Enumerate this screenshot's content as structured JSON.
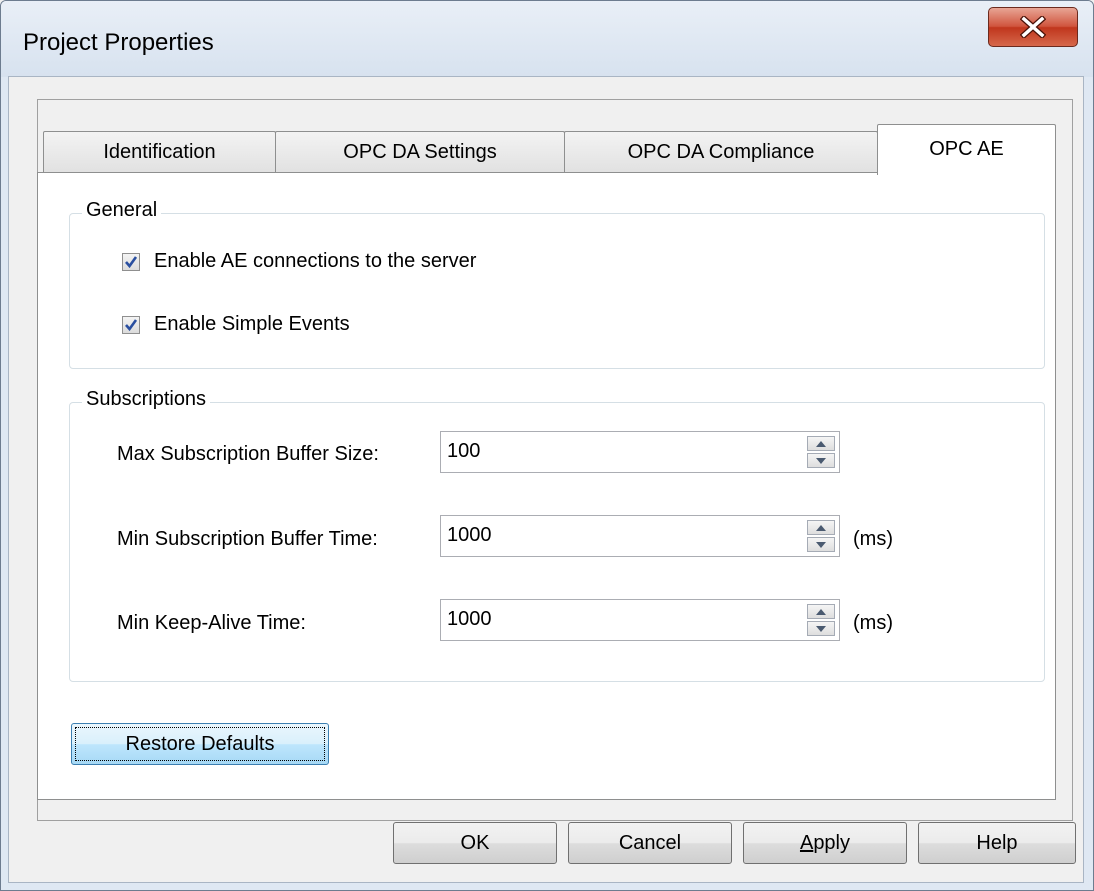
{
  "window": {
    "title": "Project Properties"
  },
  "tabs": [
    {
      "label": "Identification",
      "active": false
    },
    {
      "label": "OPC DA Settings",
      "active": false
    },
    {
      "label": "OPC DA Compliance",
      "active": false
    },
    {
      "label": "OPC AE",
      "active": true
    }
  ],
  "general": {
    "label": "General",
    "enable_ae": {
      "label": "Enable AE connections to the server",
      "checked": true
    },
    "enable_simple": {
      "label": "Enable Simple Events",
      "checked": true
    }
  },
  "subscriptions": {
    "label": "Subscriptions",
    "max_buffer_size": {
      "label": "Max Subscription Buffer Size:",
      "value": "100"
    },
    "min_buffer_time": {
      "label": "Min Subscription Buffer Time:",
      "value": "1000",
      "unit": "(ms)"
    },
    "min_keepalive": {
      "label": "Min Keep-Alive Time:",
      "value": "1000",
      "unit": "(ms)"
    }
  },
  "buttons": {
    "restore_defaults": "Restore Defaults",
    "ok": "OK",
    "cancel": "Cancel",
    "apply_prefix": "",
    "apply_accel": "A",
    "apply_rest": "pply",
    "help": "Help"
  },
  "colors": {
    "close_button": "#c0361d",
    "focus_button": "#3c7fb1",
    "check_mark": "#2a4fa0"
  }
}
